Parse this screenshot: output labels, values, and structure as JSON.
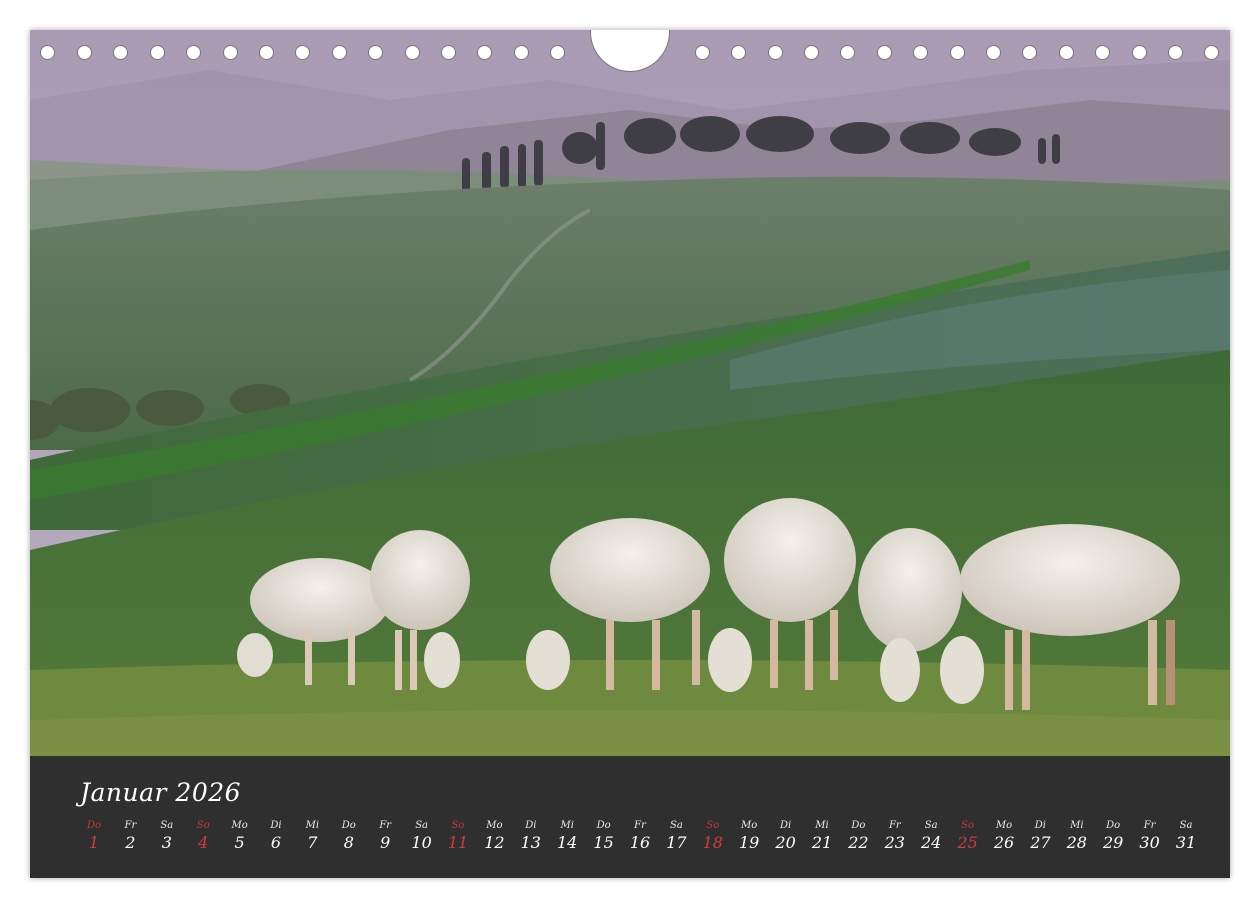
{
  "calendar": {
    "title": "Januar 2026",
    "days": [
      {
        "wd": "Do",
        "num": "1",
        "sunday": true
      },
      {
        "wd": "Fr",
        "num": "2",
        "sunday": false
      },
      {
        "wd": "Sa",
        "num": "3",
        "sunday": false
      },
      {
        "wd": "So",
        "num": "4",
        "sunday": true
      },
      {
        "wd": "Mo",
        "num": "5",
        "sunday": false
      },
      {
        "wd": "Di",
        "num": "6",
        "sunday": false
      },
      {
        "wd": "Mi",
        "num": "7",
        "sunday": false
      },
      {
        "wd": "Do",
        "num": "8",
        "sunday": false
      },
      {
        "wd": "Fr",
        "num": "9",
        "sunday": false
      },
      {
        "wd": "Sa",
        "num": "10",
        "sunday": false
      },
      {
        "wd": "So",
        "num": "11",
        "sunday": true
      },
      {
        "wd": "Mo",
        "num": "12",
        "sunday": false
      },
      {
        "wd": "Di",
        "num": "13",
        "sunday": false
      },
      {
        "wd": "Mi",
        "num": "14",
        "sunday": false
      },
      {
        "wd": "Do",
        "num": "15",
        "sunday": false
      },
      {
        "wd": "Fr",
        "num": "16",
        "sunday": false
      },
      {
        "wd": "Sa",
        "num": "17",
        "sunday": false
      },
      {
        "wd": "So",
        "num": "18",
        "sunday": true
      },
      {
        "wd": "Mo",
        "num": "19",
        "sunday": false
      },
      {
        "wd": "Di",
        "num": "20",
        "sunday": false
      },
      {
        "wd": "Mi",
        "num": "21",
        "sunday": false
      },
      {
        "wd": "Do",
        "num": "22",
        "sunday": false
      },
      {
        "wd": "Fr",
        "num": "23",
        "sunday": false
      },
      {
        "wd": "Sa",
        "num": "24",
        "sunday": false
      },
      {
        "wd": "So",
        "num": "25",
        "sunday": true
      },
      {
        "wd": "Mo",
        "num": "26",
        "sunday": false
      },
      {
        "wd": "Di",
        "num": "27",
        "sunday": false
      },
      {
        "wd": "Mi",
        "num": "28",
        "sunday": false
      },
      {
        "wd": "Do",
        "num": "29",
        "sunday": false
      },
      {
        "wd": "Fr",
        "num": "30",
        "sunday": false
      },
      {
        "wd": "Sa",
        "num": "31",
        "sunday": false
      }
    ]
  },
  "colors": {
    "bar": "#2f2f2f",
    "text": "#ffffff",
    "sunday": "#d63a3a"
  }
}
